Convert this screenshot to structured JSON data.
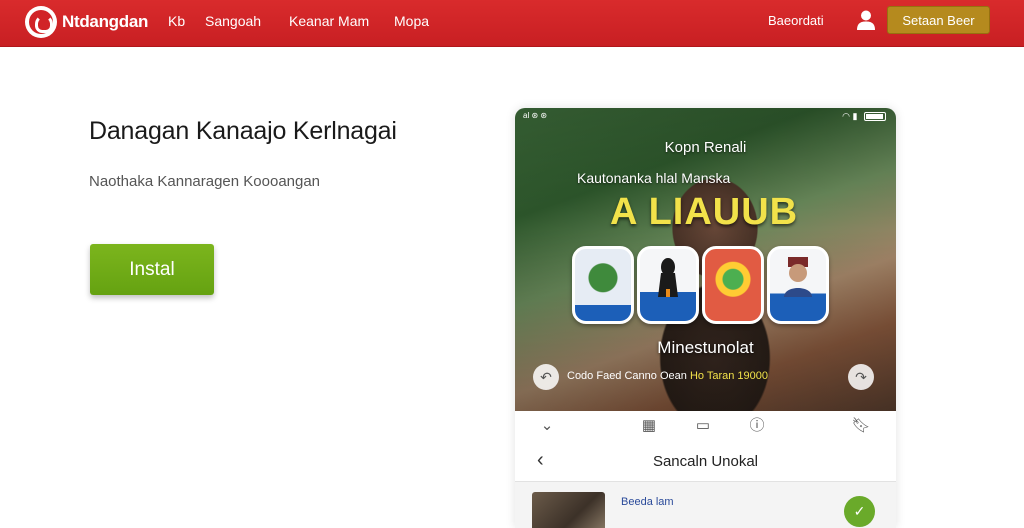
{
  "header": {
    "brand": "Ntdangdan",
    "nav": [
      "Kb",
      "Sangoah",
      "Keanar Mam",
      "Mopa"
    ],
    "signin_label": "Baeordati",
    "cta_label": "Setaan Beer",
    "accent_color": "#d12428",
    "cta_color": "#b58a1e"
  },
  "hero": {
    "title": "Danagan Kanaajo Kerlnagai",
    "subtitle": "Naothaka Kannaragen Koooangan",
    "install_label": "Instal",
    "install_color": "#72ac18"
  },
  "phone": {
    "status_left": "al ⊛ ⊛",
    "screen_title": "Kopn Renali",
    "screen_subtitle": "Kautonanka hlal Manska",
    "screen_headline": "A LIAUUB",
    "screen_caption": "Minestunolat",
    "footer_text": "Codo Faed Canno Oean",
    "footer_highlight": "Ho Taran 19000",
    "nav_title": "Sancaln Unokal",
    "list_title": "Beeda lam",
    "icons": [
      "chevron-down-icon",
      "grid-icon",
      "square-icon",
      "info-icon",
      "bookmark-icon"
    ]
  }
}
